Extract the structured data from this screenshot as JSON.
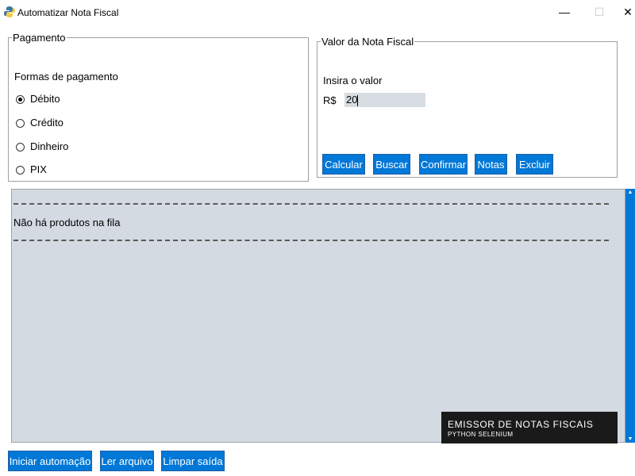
{
  "window": {
    "title": "Automatizar Nota Fiscal",
    "minimize_glyph": "—",
    "maximize_glyph": "☐",
    "close_glyph": "✕"
  },
  "payment": {
    "legend": "Pagamento",
    "heading": "Formas de pagamento",
    "options": [
      {
        "label": "Débito",
        "selected": true
      },
      {
        "label": "Crédito",
        "selected": false
      },
      {
        "label": "Dinheiro",
        "selected": false
      },
      {
        "label": "PIX",
        "selected": false
      }
    ]
  },
  "invoice": {
    "legend": "Valor da Nota Fiscal",
    "prompt": "Insira o valor",
    "currency": "R$",
    "value": "20",
    "buttons": {
      "calcular": "Calcular",
      "buscar": "Buscar",
      "confirmar": "Confirmar",
      "notas": "Notas",
      "excluir": "Excluir"
    }
  },
  "output": {
    "message": "Não há produtos na fila"
  },
  "bottom_buttons": {
    "iniciar": "Iniciar automação",
    "ler": "Ler arquivo",
    "limpar": "Limpar saída"
  },
  "brand": {
    "title": "EMISSOR DE NOTAS FISCAIS",
    "subtitle": "PYTHON  SELENIUM"
  },
  "colors": {
    "button_blue": "#0078d7",
    "output_bg": "#d4dae1",
    "input_bg": "#d8dde3",
    "brand_bg": "#1a1a1a"
  },
  "icons": {
    "app": "python-logo-icon",
    "minimize": "minimize-icon",
    "maximize": "maximize-icon",
    "close": "close-icon"
  }
}
